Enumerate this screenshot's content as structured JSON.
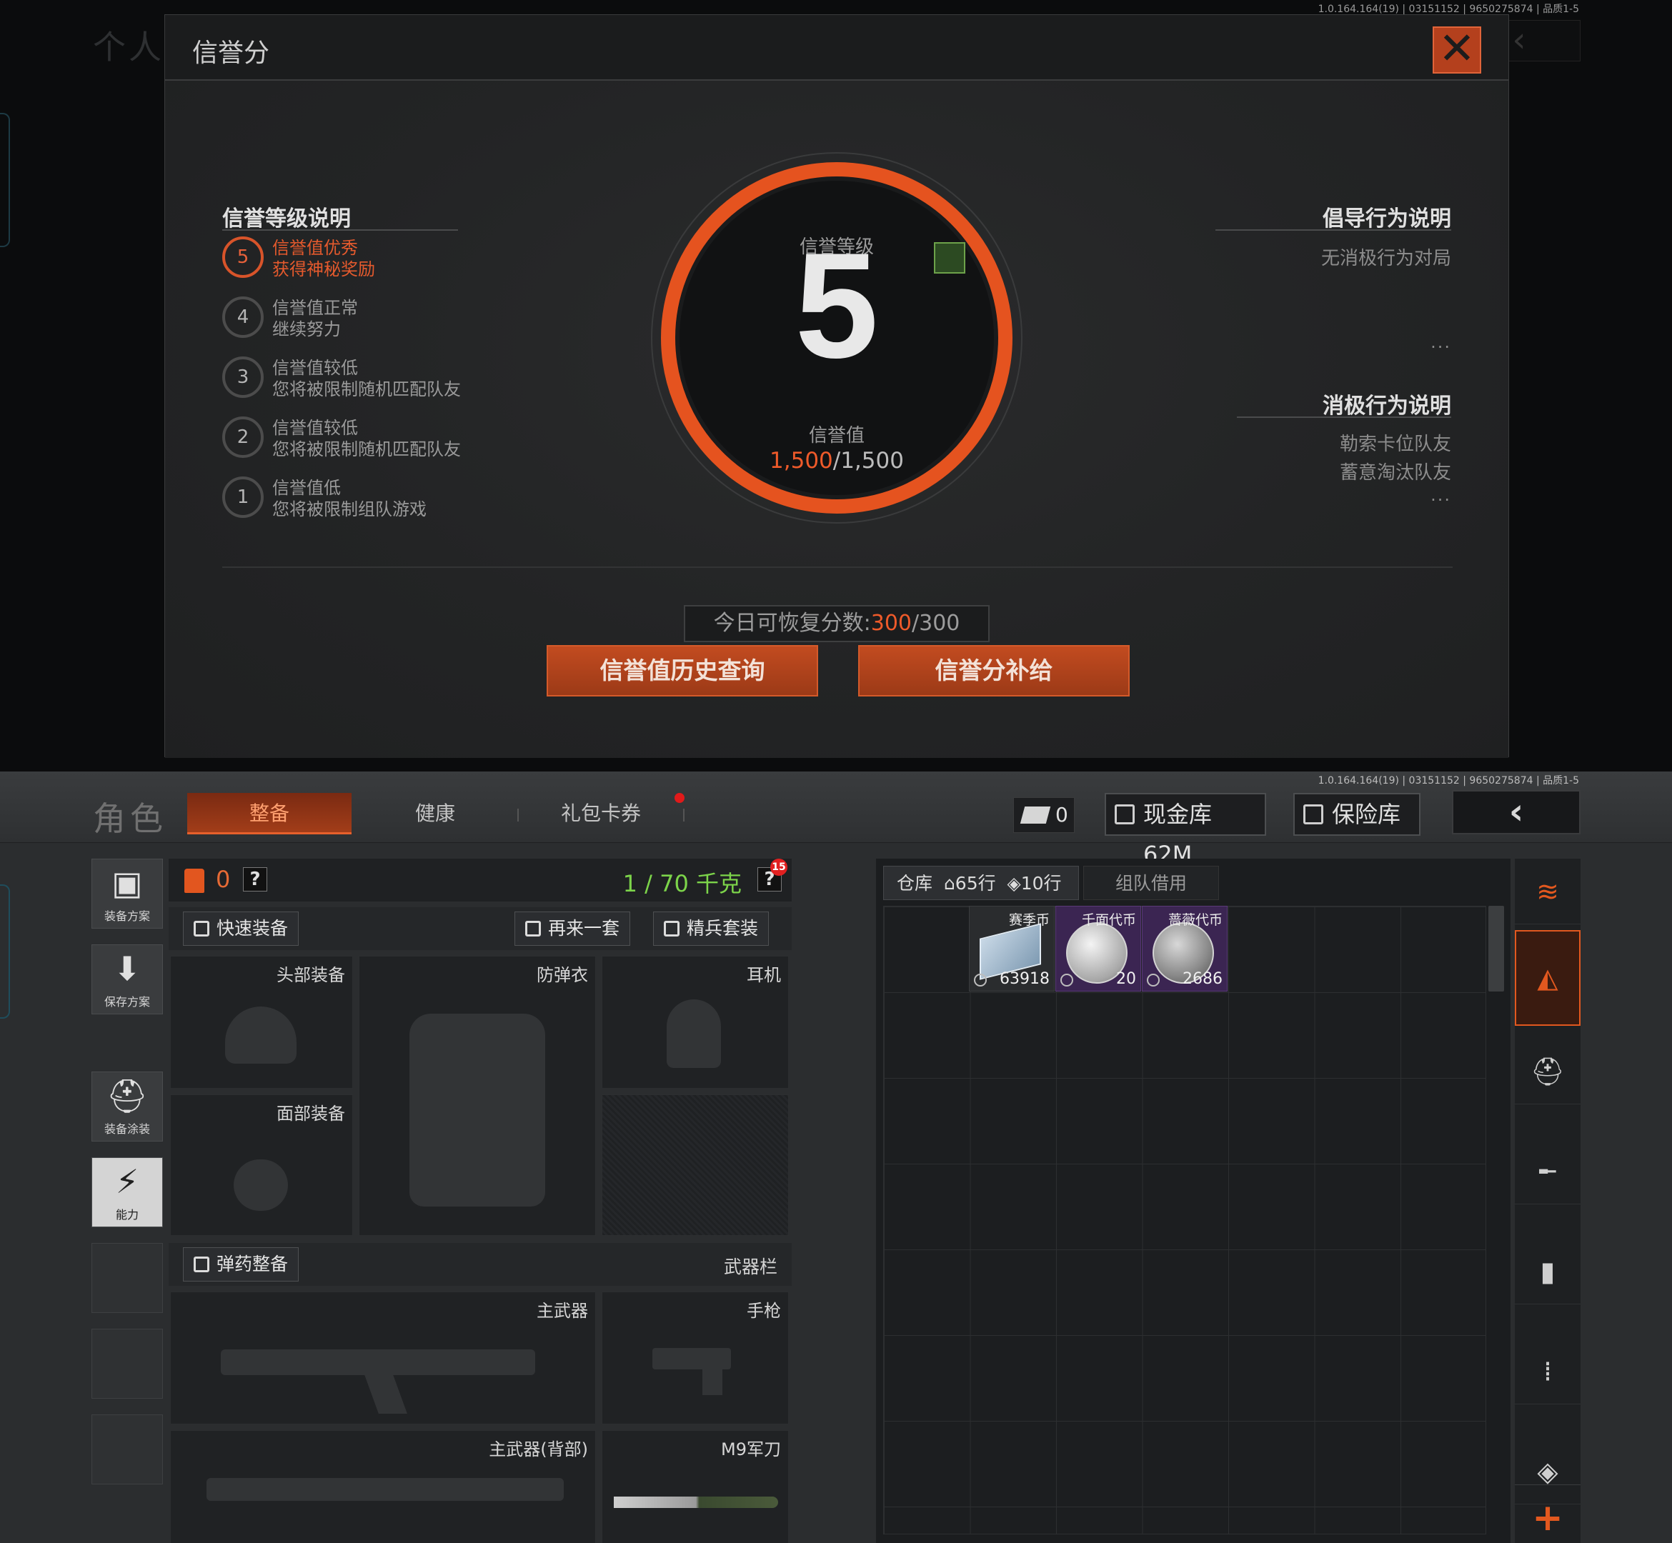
{
  "top_screen": {
    "version": "1.0.164.164(19) | 03151152 | 9650275874 | 品质1-5",
    "bg_title": "个人信",
    "dialog": {
      "title": "信誉分",
      "close": "✕",
      "left": {
        "title": "信誉等级说明",
        "levels": [
          {
            "n": "5",
            "l1": "信誉值优秀",
            "l2": "获得神秘奖励",
            "active": true
          },
          {
            "n": "4",
            "l1": "信誉值正常",
            "l2": "继续努力"
          },
          {
            "n": "3",
            "l1": "信誉值较低",
            "l2": "您将被限制随机匹配队友"
          },
          {
            "n": "2",
            "l1": "信誉值较低",
            "l2": "您将被限制随机匹配队友"
          },
          {
            "n": "1",
            "l1": "信誉值低",
            "l2": "您将被限制组队游戏"
          }
        ]
      },
      "center": {
        "level_label": "信誉等级",
        "level": "5",
        "value_label": "信誉值",
        "value_current": "1,500",
        "value_total": "/1,500"
      },
      "right": {
        "positive_title": "倡导行为说明",
        "positive_items": [
          "无消极行为对局"
        ],
        "negative_title": "消极行为说明",
        "negative_items": [
          "勒索卡位队友",
          "蓄意淘汰队友"
        ],
        "more": "..."
      },
      "recover": {
        "prefix": "今日可恢复分数:",
        "current": "300",
        "total": "/300"
      },
      "buttons": {
        "history": "信誉值历史查询",
        "supply": "信誉分补给"
      }
    }
  },
  "bottom_screen": {
    "version": "1.0.164.164(19) | 03151152 | 9650275874 | 品质1-5",
    "title": "角色",
    "tabs": [
      {
        "label": "整备",
        "active": true
      },
      {
        "label": "健康"
      },
      {
        "label": "礼包卡券"
      }
    ],
    "ticket_count": "0",
    "cash_vault": "现金库 62M",
    "safe_box": "保险库",
    "back": "‹",
    "side_buttons": [
      {
        "label": "装备方案",
        "glyph": "▣"
      },
      {
        "label": "保存方案",
        "glyph": "⬇"
      },
      {
        "label": "装备涂装",
        "glyph": "⛑"
      },
      {
        "label": "能力",
        "glyph": "⚡"
      }
    ],
    "stats": {
      "armor": "0",
      "q": "?",
      "weight": "1 / 70 千克"
    },
    "actions": {
      "quick": "快速装备",
      "again": "再来一套",
      "elite": "精兵套装",
      "elite_badge": "15"
    },
    "slots": {
      "head": "头部装备",
      "vest": "防弹衣",
      "ear": "耳机",
      "face": "面部装备",
      "ammo": "弹药整备",
      "weapon_bar": "武器栏",
      "main": "主武器",
      "pistol": "手枪",
      "main_back": "主武器(背部)",
      "knife": "M9军刀"
    },
    "warehouse": {
      "tab1": "仓库",
      "rows_a": "65行",
      "rows_b": "10行",
      "tab2": "组队借用",
      "items": [
        {
          "name": "赛季币",
          "qty": "63918",
          "style": "plain"
        },
        {
          "name": "千面代币",
          "qty": "20",
          "style": "purple"
        },
        {
          "name": "蔷薇代币",
          "qty": "2686",
          "style": "purple"
        }
      ]
    },
    "categories": [
      "stack-icon",
      "box-icon",
      "helmet-icon",
      "rifle-icon",
      "magazine-icon",
      "bullet-icon",
      "vest-icon",
      "plus-icon"
    ]
  }
}
